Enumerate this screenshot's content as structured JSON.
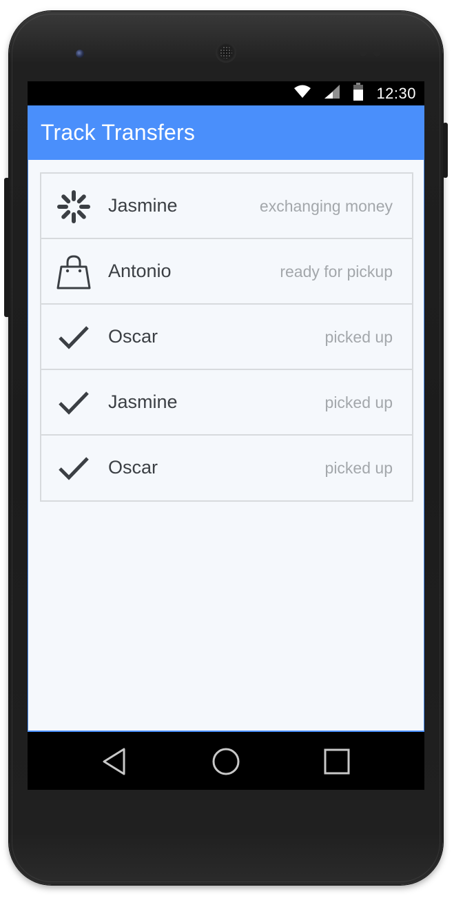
{
  "status_bar": {
    "time": "12:30",
    "icons": [
      "wifi-icon",
      "signal-icon",
      "battery-icon"
    ]
  },
  "app_bar": {
    "title": "Track Transfers",
    "color": "#4a8ffb"
  },
  "transfers": [
    {
      "name": "Jasmine",
      "status": "exchanging money",
      "icon": "loading-spinner-icon"
    },
    {
      "name": "Antonio",
      "status": "ready for pickup",
      "icon": "shopping-bag-icon"
    },
    {
      "name": "Oscar",
      "status": "picked up",
      "icon": "checkmark-icon"
    },
    {
      "name": "Jasmine",
      "status": "picked up",
      "icon": "checkmark-icon"
    },
    {
      "name": "Oscar",
      "status": "picked up",
      "icon": "checkmark-icon"
    }
  ],
  "nav_bar": {
    "buttons": [
      "back-icon",
      "home-icon",
      "recent-apps-icon"
    ]
  },
  "colors": {
    "list_background": "#f5f8fc",
    "divider": "#d7dadd",
    "name_text": "#3b3f44",
    "status_text": "#a3a7ab"
  }
}
